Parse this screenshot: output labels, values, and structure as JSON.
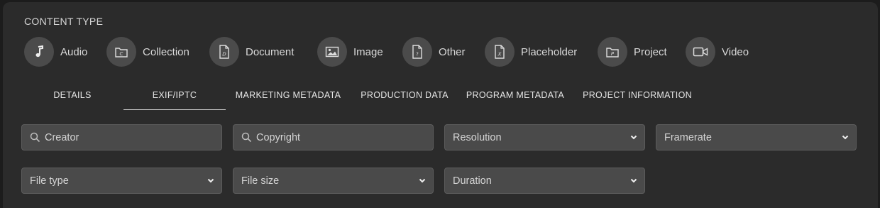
{
  "content_type": {
    "label": "CONTENT TYPE",
    "items": [
      {
        "label": "Audio",
        "icon": "music-note-icon"
      },
      {
        "label": "Collection",
        "icon": "collection-icon",
        "glyph": "C"
      },
      {
        "label": "Document",
        "icon": "document-icon",
        "glyph": "D"
      },
      {
        "label": "Image",
        "icon": "image-icon"
      },
      {
        "label": "Other",
        "icon": "other-file-icon",
        "glyph": "?"
      },
      {
        "label": "Placeholder",
        "icon": "placeholder-file-icon",
        "glyph": "X"
      },
      {
        "label": "Project",
        "icon": "project-icon",
        "glyph": "P"
      },
      {
        "label": "Video",
        "icon": "video-camera-icon"
      }
    ]
  },
  "tabs": [
    {
      "label": "DETAILS",
      "active": false
    },
    {
      "label": "EXIF/IPTC",
      "active": true
    },
    {
      "label": "MARKETING METADATA",
      "active": false
    },
    {
      "label": "PRODUCTION DATA",
      "active": false
    },
    {
      "label": "PROGRAM METADATA",
      "active": false
    },
    {
      "label": "PROJECT INFORMATION",
      "active": false
    }
  ],
  "filters": {
    "creator": {
      "placeholder": "Creator",
      "icon": "search-icon"
    },
    "copyright": {
      "placeholder": "Copyright",
      "icon": "search-icon"
    },
    "resolution": {
      "value": "Resolution",
      "icon": "chevron-down-icon"
    },
    "framerate": {
      "value": "Framerate",
      "icon": "chevron-down-icon"
    },
    "file_type": {
      "value": "File type",
      "icon": "chevron-down-icon"
    },
    "file_size": {
      "value": "File size",
      "icon": "chevron-down-icon"
    },
    "duration": {
      "value": "Duration",
      "icon": "chevron-down-icon"
    }
  },
  "colors": {
    "background": "#2b2b2b",
    "icon_circle": "#4b4b4b",
    "field_bg": "#4a4a4a",
    "text": "#d9d9d9"
  }
}
